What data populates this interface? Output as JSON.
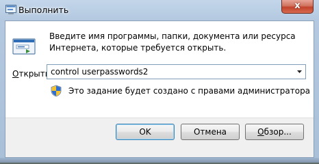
{
  "window": {
    "title": "Выполнить",
    "close_symbol": "x"
  },
  "dialog": {
    "description": "Введите имя программы, папки, документа или ресурса Интернета, которые требуется открыть.",
    "open_label_accel": "О",
    "open_label_rest": "ткрыть:",
    "input_value": "control userpasswords2",
    "admin_note": "Это задание будет создано с правами администратора"
  },
  "buttons": {
    "ok": "OK",
    "cancel": "Отмена",
    "browse_accel": "О",
    "browse_rest": "бзор..."
  },
  "icons": {
    "title_icon": "run-icon",
    "main_icon": "run-window-icon",
    "shield": "uac-shield-icon",
    "dropdown": "chevron-down-icon",
    "close": "close-icon"
  },
  "colors": {
    "frame": "#b4c9e0",
    "close_button": "#c2432c",
    "default_button_border": "#3c7fb1"
  }
}
